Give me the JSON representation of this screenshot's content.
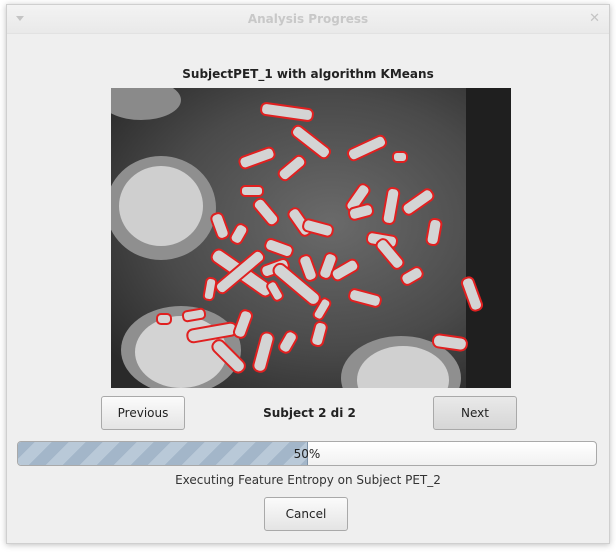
{
  "window": {
    "title": "Analysis Progress"
  },
  "subject_title": "SubjectPET_1 with algorithm KMeans",
  "navigation": {
    "previous_label": "Previous",
    "counter": "Subject 2 di 2",
    "next_label": "Next"
  },
  "progress": {
    "value": 50,
    "text": "50%"
  },
  "status_text": "Executing Feature Entropy on Subject PET_2",
  "cancel_label": "Cancel",
  "colors": {
    "segment_outline": "#e02020",
    "progress_fill": "#a3b6c9",
    "background": "#efefef"
  },
  "icons": {
    "menu": "chevron-down-icon",
    "close": "close-icon"
  }
}
